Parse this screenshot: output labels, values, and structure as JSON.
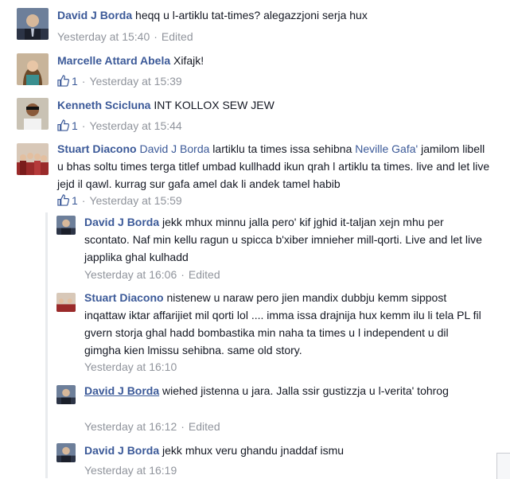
{
  "colors": {
    "link": "#3b5998",
    "meta": "#90949c",
    "text": "#141823",
    "thread_line": "#e9ebee"
  },
  "comments": [
    {
      "author": "David J Borda",
      "text": "heqq u l-artiklu tat-times? alegazzjoni serja hux",
      "timestamp": "Yesterday at 15:40",
      "edited": "Edited"
    },
    {
      "author": "Marcelle Attard Abela",
      "text": "Xifajk!",
      "likes": "1",
      "timestamp": "Yesterday at 15:39"
    },
    {
      "author": "Kenneth Scicluna",
      "text": "INT KOLLOX SEW JEW",
      "likes": "1",
      "timestamp": "Yesterday at 15:44"
    },
    {
      "author": "Stuart Diacono",
      "mention1": "David J Borda",
      "text1": " lartiklu ta times issa sehibna ",
      "mention2": "Neville Gafa'",
      "text2": " jamilom libell u bhas soltu times terga titlef umbad kullhadd ikun qrah l artiklu ta times. live and let live jejd il qawl. kurrag sur gafa amel dak li andek tamel habib",
      "likes": "1",
      "timestamp": "Yesterday at 15:59"
    }
  ],
  "replies": [
    {
      "author": "David J Borda",
      "text": " jekk mhux minnu jalla pero' kif jghid it-taljan xejn mhu per scontato. Naf min kellu ragun u spicca b'xiber imnieher mill-qorti. Live and let live japplika ghal kulhadd",
      "timestamp": "Yesterday at 16:06",
      "edited": "Edited"
    },
    {
      "author": "Stuart Diacono",
      "text": " nistenew u naraw pero jien mandix dubbju kemm sippost inqattaw iktar affarijiet mil qorti lol .... imma issa drajnija hux kemm ilu li tela PL fil gvern storja ghal hadd bombastika min naha ta times u l independent u dil gimgha kien lmissu sehibna. same old story.",
      "timestamp": "Yesterday at 16:10"
    },
    {
      "author": "David J Borda",
      "text": " wiehed jistenna u jara. Jalla ssir gustizzja u l-verita' tohrog",
      "timestamp": "Yesterday at 16:12",
      "edited": "Edited"
    },
    {
      "author": "David J Borda",
      "text": " jekk mhux veru ghandu jnaddaf ismu",
      "timestamp": "Yesterday at 16:19"
    }
  ]
}
